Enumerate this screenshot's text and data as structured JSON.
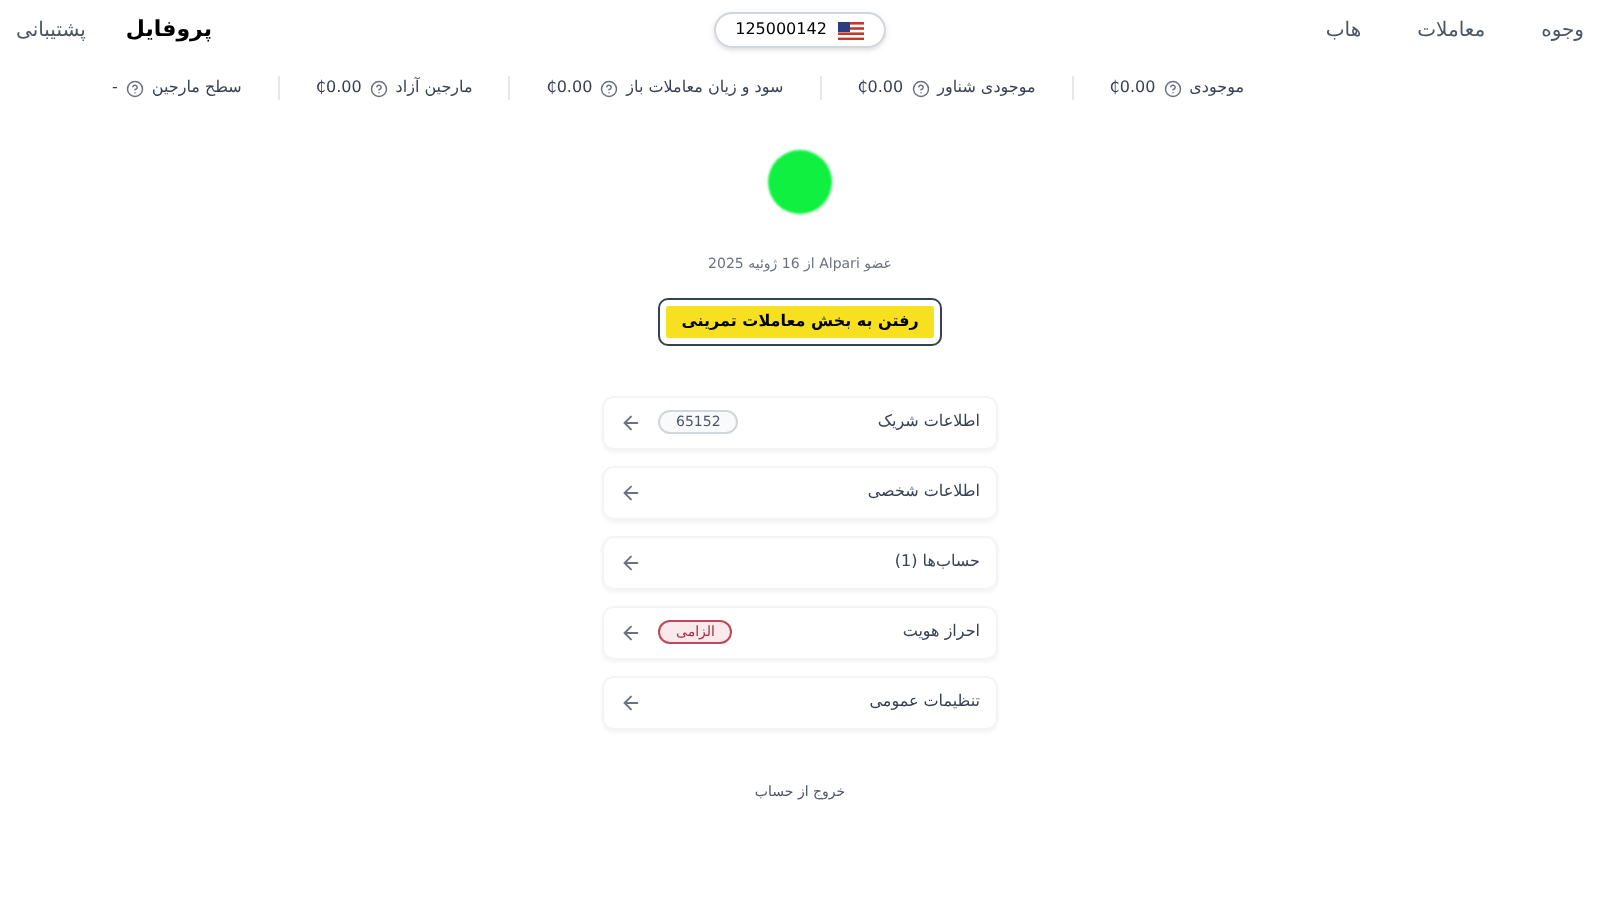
{
  "nav_main": [
    {
      "label": "وجوه",
      "selected": false
    },
    {
      "label": "معاملات",
      "selected": false
    },
    {
      "label": "هاب",
      "selected": false
    }
  ],
  "account": {
    "number": "125000142"
  },
  "nav_user": [
    {
      "label": "پروفایل",
      "selected": true
    },
    {
      "label": "پشتیبانی",
      "selected": false
    }
  ],
  "stats": [
    {
      "label": "موجودی",
      "value": "₵0.00"
    },
    {
      "label": "موجودی شناور",
      "value": "₵0.00"
    },
    {
      "label": "سود و زیان معاملات باز",
      "value": "₵0.00"
    },
    {
      "label": "مارجین آزاد",
      "value": "₵0.00"
    },
    {
      "label": "سطح مارجین",
      "value": "-"
    }
  ],
  "profile": {
    "member_since": "عضو Alpari از 16 ژوئیه 2025",
    "demo_button": "رفتن به بخش معاملات تمرینی"
  },
  "menu": [
    {
      "label": "اطلاعات شریک",
      "badge": {
        "text": "65152",
        "kind": "neutral"
      }
    },
    {
      "label": "اطلاعات شخصی"
    },
    {
      "label": "حساب‌ها (1)"
    },
    {
      "label": "احراز هویت",
      "badge": {
        "text": "الزامی",
        "kind": "required"
      }
    },
    {
      "label": "تنظیمات عمومی"
    }
  ],
  "logout": "خروج از حساب"
}
